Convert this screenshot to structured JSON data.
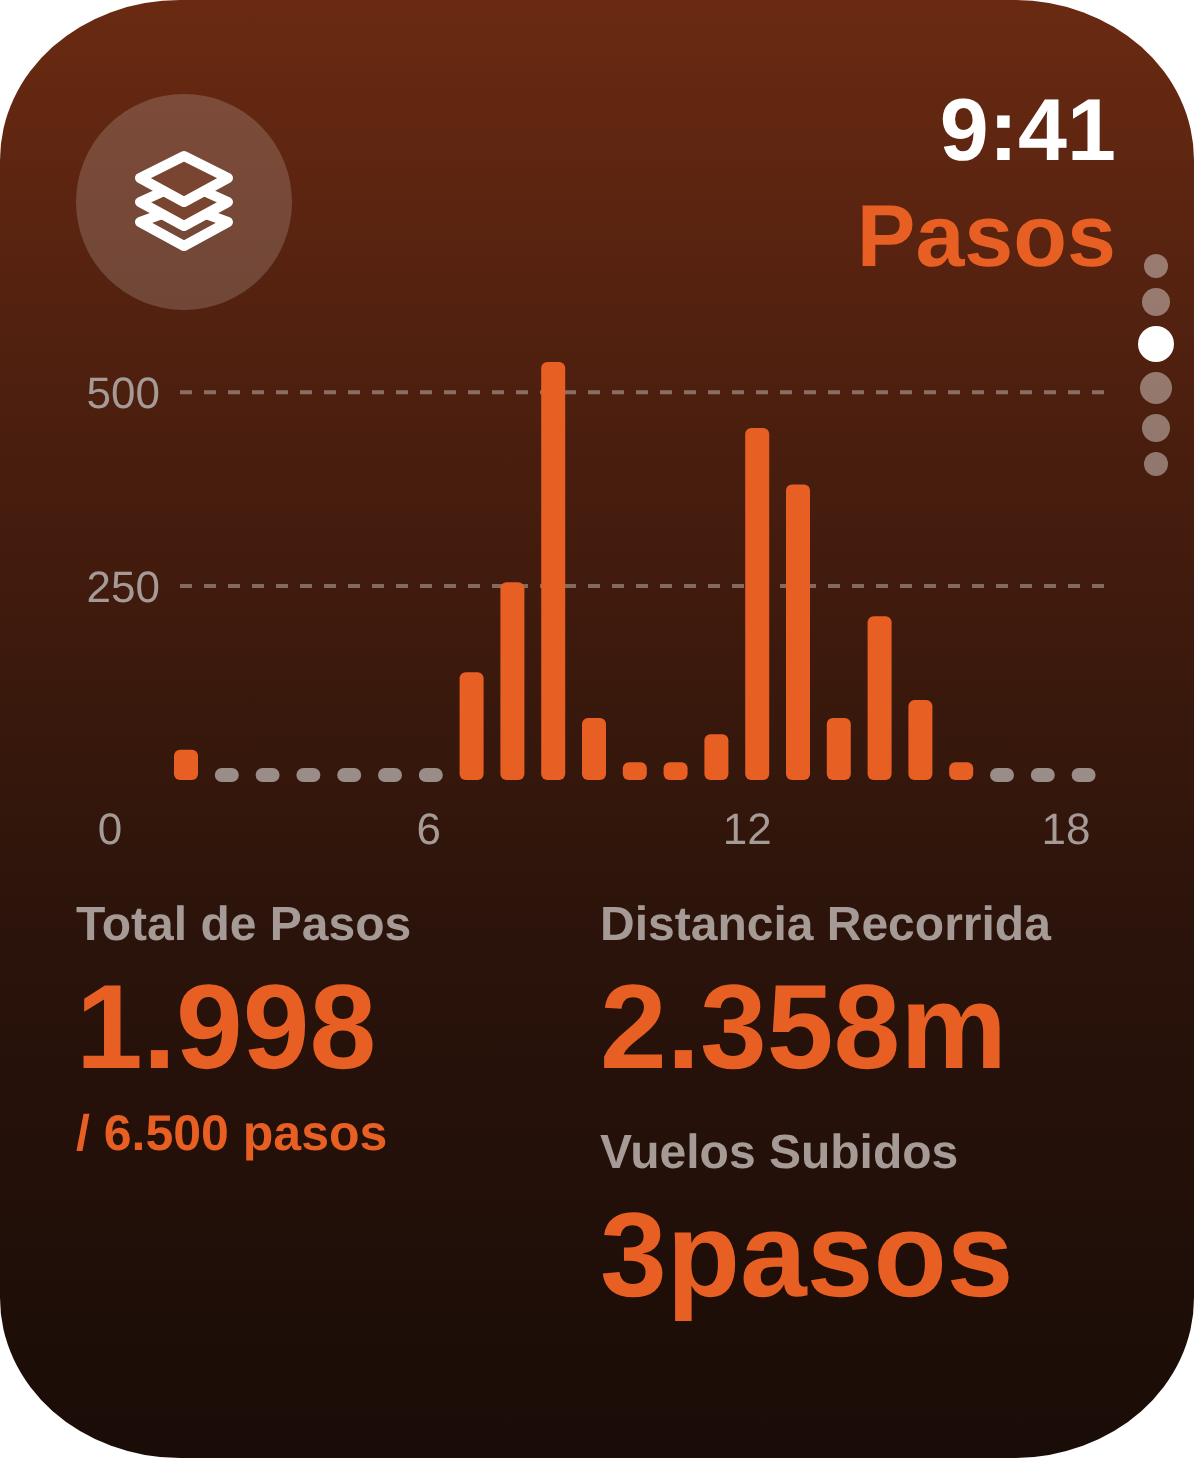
{
  "status": {
    "time": "9:41"
  },
  "title": "Pasos",
  "page_dots": [
    {
      "selected": false
    },
    {
      "selected": false
    },
    {
      "selected": true
    },
    {
      "selected": false
    },
    {
      "selected": false
    },
    {
      "selected": false
    }
  ],
  "chart": {
    "x_axis_labels": [
      "0",
      "6",
      "12",
      "18"
    ],
    "chart_data": {
      "type": "bar",
      "ylim": [
        0,
        539
      ],
      "yticks": [
        250,
        500
      ],
      "series": [
        {
          "color": "#e85f24",
          "values": [
            39,
            null,
            null,
            null,
            null,
            null,
            null,
            139,
            255,
            539,
            80,
            23,
            23,
            59,
            454,
            381,
            80,
            211,
            103,
            23,
            null,
            null,
            null
          ]
        }
      ]
    }
  },
  "stats": [
    {
      "label": "Total de Pasos",
      "value": "1.998",
      "detail": "/ 6.500 pasos"
    },
    {
      "label": "Distancia Recorrida",
      "value": "2.358m"
    },
    {
      "label": "Vuelos Subidos",
      "value": "3pasos"
    }
  ]
}
